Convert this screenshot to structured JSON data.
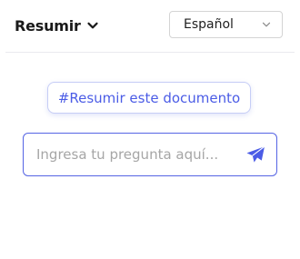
{
  "header": {
    "mode_label": "Resumir",
    "mode_icon": "chevron-down-icon",
    "language": {
      "selected": "Español",
      "icon": "chevron-down-icon"
    }
  },
  "suggestion": {
    "label": "#Resumir este documento"
  },
  "question": {
    "value": "",
    "placeholder": "Ingresa tu pregunta aquí...",
    "send_icon": "send-icon"
  },
  "colors": {
    "accent": "#4b5ce6",
    "input_border": "#5564e4",
    "chip_border": "#c6cdf6",
    "select_border": "#d4d4d4",
    "title_text": "#1a1a1a"
  }
}
